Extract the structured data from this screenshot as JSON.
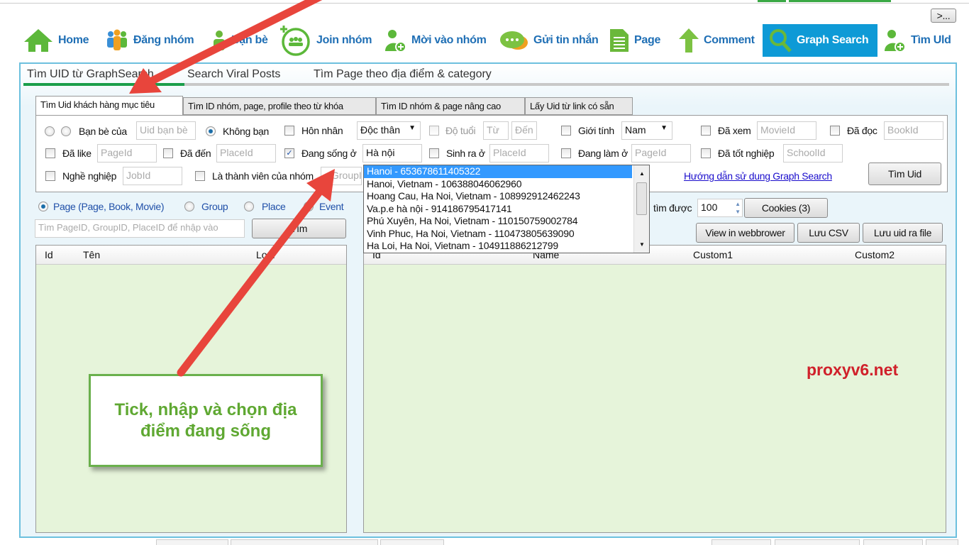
{
  "toolbar": {
    "more_label": ">...",
    "items": [
      {
        "label": "Home",
        "icon": "home-icon"
      },
      {
        "label": "Đăng nhóm",
        "icon": "people-icon"
      },
      {
        "label": "Bạn bè",
        "icon": "person-icon"
      },
      {
        "label": "Join nhóm",
        "icon": "join-group-icon"
      },
      {
        "label": "Mời vào nhóm",
        "icon": "add-user-icon"
      },
      {
        "label": "Gửi tin nhắn",
        "icon": "chat-icon"
      },
      {
        "label": "Page",
        "icon": "document-icon"
      },
      {
        "label": "Comment",
        "icon": "arrow-up-icon"
      },
      {
        "label": "Graph Search",
        "icon": "search-icon"
      },
      {
        "label": "Tìm Uld",
        "icon": "add-user-icon"
      }
    ],
    "active": "Graph Search",
    "accent": "#0e9ad6"
  },
  "top_tabs": [
    "Tìm UID từ GraphSearch",
    "Search Viral Posts",
    "Tìm Page theo địa điểm & category"
  ],
  "inner_tabs": [
    "Tìm Uid khách hàng mục tiêu",
    "Tìm ID nhóm, page,  profile theo từ khóa",
    "Tìm ID nhóm & page nâng cao",
    "Lấy Uid từ link có sẵn"
  ],
  "filters": {
    "ban_be_cua": "Bạn bè của",
    "uid_ban_be_ph": "Uid bạn bè",
    "khong_ban": "Không bạn",
    "hon_nhan": "Hôn nhân",
    "hon_nhan_value": "Độc thân",
    "do_tuoi": "Độ tuổi",
    "tu_ph": "Từ",
    "den_ph": "Đến",
    "gioi_tinh": "Giới tính",
    "gioi_tinh_value": "Nam",
    "da_xem": "Đã xem",
    "movie_ph": "MovieId",
    "da_doc": "Đã đọc",
    "book_ph": "BookId",
    "da_like": "Đã like",
    "page_ph": "PageId",
    "da_den": "Đã đến",
    "place_ph": "PlaceId",
    "dang_song_o": "Đang sống ở",
    "dang_song_o_value": "Hà nội",
    "sinh_ra_o": "Sinh ra ở",
    "sinh_ra_ph": "PlaceId",
    "dang_lam_o": "Đang làm ở",
    "dang_lam_ph": "PageId",
    "da_tot_nghiep": "Đã tốt nghiệp",
    "school_ph": "SchoolId",
    "nghe_nghiep": "Nghề nghiệp",
    "job_ph": "JobId",
    "thanh_vien": "Là thành viên của nhóm",
    "group_ph": "GroupId",
    "help_link": "Hướng dẫn sử dung Graph Search",
    "search_button": "Tìm Uid"
  },
  "location_suggestions": [
    "Hanoi - 653678611405322",
    "Hanoi, Vietnam - 106388046062960",
    "Hoang Cau, Ha Noi, Vietnam - 108992912462243",
    "Va.p.e hà nội - 914186795417141",
    "Phú Xuyên, Ha Noi, Vietnam - 110150759002784",
    "Vinh Phuc, Ha Noi, Vietnam - 110473805639090",
    "Ha Loi, Ha Noi, Vietnam - 104911886212799"
  ],
  "left_panel": {
    "types": [
      "Page (Page, Book, Movie)",
      "Group",
      "Place",
      "Event"
    ],
    "search_ph": "Tìm PageID, GroupID, PlaceID để nhập vào",
    "search_button": "Tìm",
    "columns": [
      "Id",
      "Tên",
      "Loại"
    ]
  },
  "right_panel": {
    "found_label": "tìm được",
    "found_value": "100",
    "cookies_button": "Cookies (3)",
    "view_button": "View in webbrower",
    "csv_button": "Lưu CSV",
    "save_button": "Lưu uid ra file",
    "columns": [
      "Id",
      "Name",
      "Custom1",
      "Custom2"
    ]
  },
  "annotation": {
    "callout": "Tick, nhập và chọn địa điểm đang sống",
    "arrow_color": "#e8453c"
  },
  "watermark": "proxyv6.net"
}
